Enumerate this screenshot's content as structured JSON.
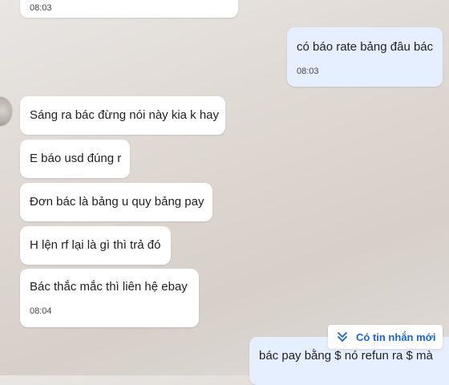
{
  "messages": [
    {
      "direction": "in",
      "text": "",
      "time": "08:03"
    },
    {
      "direction": "out",
      "text": "có báo rate bảng đâu bác",
      "time": "08:03"
    },
    {
      "direction": "in",
      "text": "Sáng ra bác đừng nói này kia k hay",
      "time": ""
    },
    {
      "direction": "in",
      "text": "E báo usd đúng r",
      "time": ""
    },
    {
      "direction": "in",
      "text": "Đơn bác là bảng u quy bảng pay",
      "time": ""
    },
    {
      "direction": "in",
      "text": "H lện rf lại là gì thì trả đó",
      "time": ""
    },
    {
      "direction": "in",
      "text": "Bác thắc mắc thì liên hệ ebay",
      "time": "08:04"
    },
    {
      "direction": "out",
      "text": "bác pay bằng $ nó refun ra $ mà",
      "time": ""
    }
  ],
  "new_message_button": {
    "label": "Có tin nhắn mới",
    "icon": "double-chevron-down-icon"
  },
  "colors": {
    "incoming_bubble": "#ffffff",
    "outgoing_bubble": "#e6efff",
    "accent": "#1a66c9"
  }
}
